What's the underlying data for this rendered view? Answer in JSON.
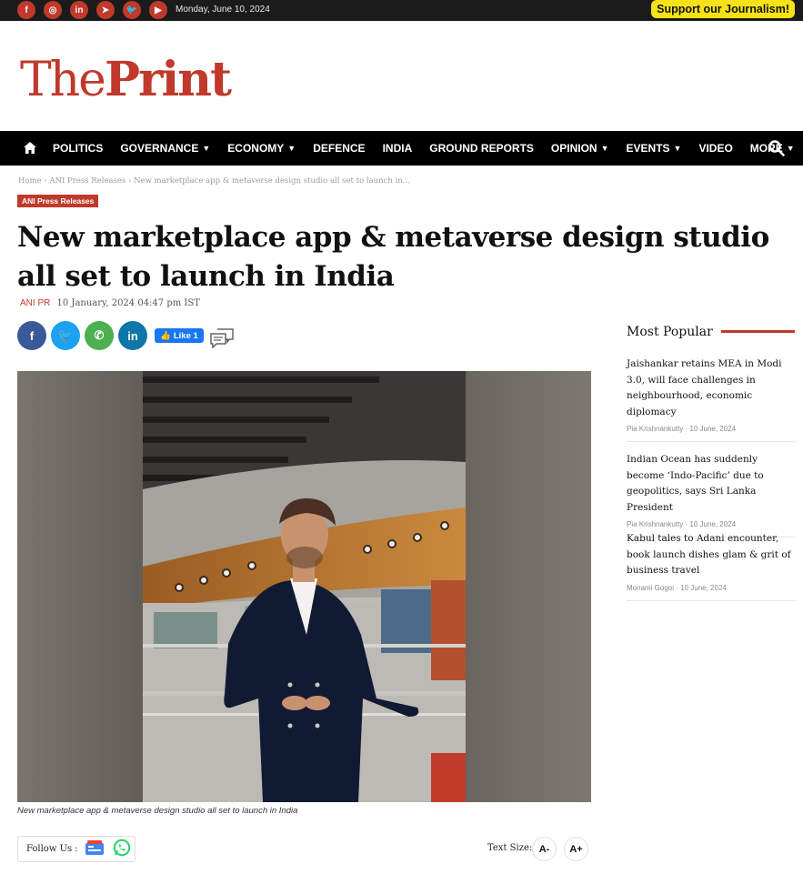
{
  "topbar": {
    "social": [
      {
        "icon": "facebook-icon",
        "glyph": "f"
      },
      {
        "icon": "instagram-icon",
        "glyph": "◎"
      },
      {
        "icon": "linkedin-icon",
        "glyph": "in"
      },
      {
        "icon": "telegram-icon",
        "glyph": "➤"
      },
      {
        "icon": "twitter-icon",
        "glyph": "🐦"
      },
      {
        "icon": "youtube-icon",
        "glyph": "▶"
      }
    ],
    "date": "Monday, June 10, 2024",
    "support_label": "Support our Journalism!"
  },
  "logo": {
    "part1": "The",
    "part2": "Print"
  },
  "nav": {
    "items": [
      {
        "label": "POLITICS",
        "dropdown": false
      },
      {
        "label": "GOVERNANCE",
        "dropdown": true
      },
      {
        "label": "ECONOMY",
        "dropdown": true
      },
      {
        "label": "DEFENCE",
        "dropdown": false
      },
      {
        "label": "INDIA",
        "dropdown": false
      },
      {
        "label": "GROUND REPORTS",
        "dropdown": false
      },
      {
        "label": "OPINION",
        "dropdown": true
      },
      {
        "label": "EVENTS",
        "dropdown": true
      },
      {
        "label": "VIDEO",
        "dropdown": false
      },
      {
        "label": "MORE",
        "dropdown": true
      }
    ]
  },
  "breadcrumb": "Home  ›  ANI Press Releases  ›  New marketplace app & metaverse design studio all set to launch in...",
  "article": {
    "tag": "ANI Press Releases",
    "headline": "New marketplace app & metaverse design studio all set to launch in India",
    "author": "ANI PR",
    "datetime": "10 January, 2024 04:47 pm IST",
    "like_label": "Like 1",
    "caption": "New marketplace app & metaverse design studio all set to launch in India"
  },
  "share": [
    {
      "icon": "facebook-share-icon",
      "glyph": "f",
      "color": "#3b5998"
    },
    {
      "icon": "twitter-share-icon",
      "glyph": "🐦",
      "color": "#1da1f2"
    },
    {
      "icon": "whatsapp-share-icon",
      "glyph": "✆",
      "color": "#4caf50"
    },
    {
      "icon": "linkedin-share-icon",
      "glyph": "in",
      "color": "#0e76a8"
    }
  ],
  "footer_bar": {
    "follow_label": "Follow Us :",
    "text_size_label": "Text Size:",
    "decrease_label": "A-",
    "increase_label": "A+"
  },
  "sidebar": {
    "title": "Most Popular",
    "items": [
      {
        "title": "Jaishankar retains MEA in Modi 3.0, will face challenges in neighbourhood, economic diplomacy",
        "author": "Pia Krishnankutty",
        "date": "10 June, 2024"
      },
      {
        "title": "Indian Ocean has suddenly become ‘Indo-Pacific’ due to geopolitics, says Sri Lanka President",
        "author": "Pia Krishnankutty",
        "date": "10 June, 2024"
      },
      {
        "title": "Kabul tales to Adani encounter, book launch dishes glam & grit of business travel",
        "author": "Monami Gogoi",
        "date": "10 June, 2024"
      }
    ]
  },
  "colors": {
    "brand": "#c0392b",
    "nav_bg": "#000000",
    "support_bg": "#f7e21a"
  }
}
